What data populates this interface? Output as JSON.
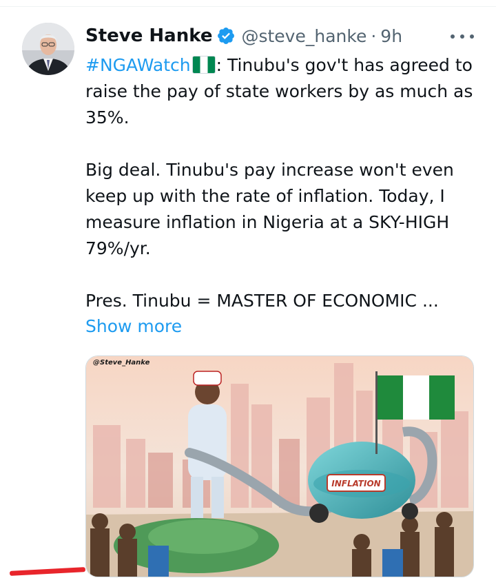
{
  "tweet": {
    "author": {
      "name": "Steve Hanke",
      "handle": "@steve_hanke",
      "verified": true,
      "avatar_icon": "profile-photo"
    },
    "separator": "·",
    "time": "9h",
    "more_icon": "more-dots-icon",
    "hashtag": "#NGAWatch",
    "flag_emoji": "nigeria-flag",
    "text_line1_rest": ": Tinubu's gov't has agreed to raise the pay of state workers by as much as 35%.",
    "paragraph2": "Big deal. Tinubu's pay increase won't even keep up with the rate of inflation. Today, I measure inflation in Nigeria at a SKY-HIGH 79%/yr.",
    "paragraph3": "Pres. Tinubu =  MASTER OF ECONOMIC ...",
    "show_more": "Show more",
    "media": {
      "watermark": "@Steve_Hanke",
      "tank_label": "INFLATION"
    }
  },
  "colors": {
    "link": "#1d9bf0",
    "secondary": "#536471",
    "verified": "#1d9bf0",
    "red_mark": "#e8252b"
  }
}
